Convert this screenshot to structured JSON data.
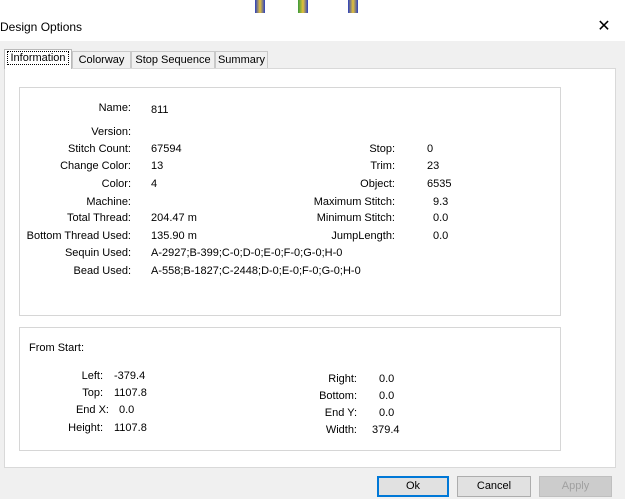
{
  "window": {
    "title": "Design Options",
    "close_glyph": "✕"
  },
  "tabs": [
    {
      "label": "Information",
      "active": true
    },
    {
      "label": "Colorway",
      "active": false
    },
    {
      "label": "Stop Sequence",
      "active": false
    },
    {
      "label": "Summary",
      "active": false
    }
  ],
  "info": {
    "name_label": "Name:",
    "name": "811",
    "version_label": "Version:",
    "version": "",
    "stitch_count_label": "Stitch Count:",
    "stitch_count": "67594",
    "change_color_label": "Change Color:",
    "change_color": "13",
    "color_label": "Color:",
    "color": "4",
    "machine_label": "Machine:",
    "machine": "",
    "total_thread_label": "Total Thread:",
    "total_thread": "204.47 m",
    "bottom_thread_label": "Bottom Thread Used:",
    "bottom_thread": "135.90 m",
    "sequin_label": "Sequin Used:",
    "sequin": "A-2927;B-399;C-0;D-0;E-0;F-0;G-0;H-0",
    "bead_label": "Bead Used:",
    "bead": "A-558;B-1827;C-2448;D-0;E-0;F-0;G-0;H-0",
    "stop_label": "Stop:",
    "stop": "0",
    "trim_label": "Trim:",
    "trim": "23",
    "object_label": "Object:",
    "object": "6535",
    "max_stitch_label": "Maximum Stitch:",
    "max_stitch": "9.3",
    "min_stitch_label": "Minimum Stitch:",
    "min_stitch": "0.0",
    "jump_length_label": "JumpLength:",
    "jump_length": "0.0"
  },
  "from_start": {
    "heading": "From Start:",
    "left_label": "Left:",
    "left": "-379.4",
    "top_label": "Top:",
    "top": "1107.8",
    "end_x_label": "End X:",
    "end_x": "0.0",
    "height_label": "Height:",
    "height": "1107.8",
    "right_label": "Right:",
    "right": "0.0",
    "bottom_label": "Bottom:",
    "bottom": "0.0",
    "end_y_label": "End Y:",
    "end_y": "0.0",
    "width_label": "Width:",
    "width": "379.4"
  },
  "buttons": {
    "ok": "Ok",
    "cancel": "Cancel",
    "apply": "Apply"
  },
  "colors": {
    "accent": "#0078d7",
    "border": "#d6d6d6",
    "window_bg": "#f0f0f0"
  }
}
